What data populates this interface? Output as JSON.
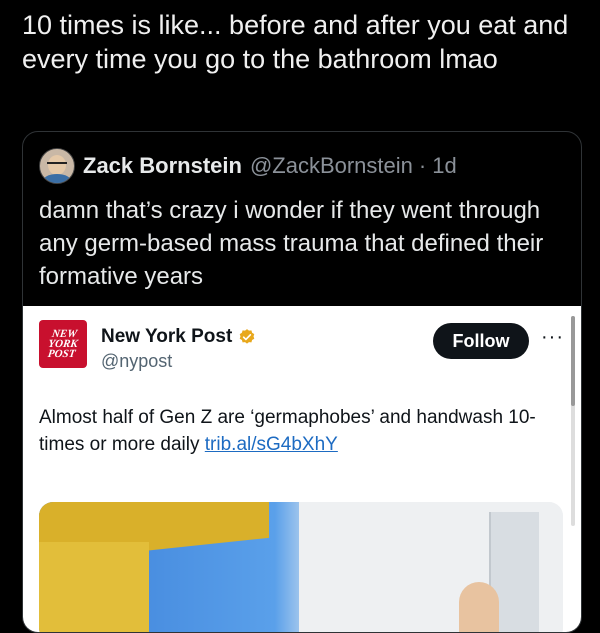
{
  "tweet": {
    "text": "10 times is like... before and after you eat and every time you go to the bathroom lmao"
  },
  "quote": {
    "author_name": "Zack Bornstein",
    "author_handle": "@ZackBornstein",
    "separator": "·",
    "time": "1d",
    "text": "damn that’s crazy i wonder if they went through any germ-based mass trauma that defined their formative years"
  },
  "embed": {
    "logo_text": "NEW YORK POST",
    "name": "New York Post",
    "handle": "@nypost",
    "follow_label": "Follow",
    "more_label": "···",
    "text": "Almost half of Gen Z are ‘germaphobes’ and handwash 10-times or more daily ",
    "link_text": "trib.al/sG4bXhY"
  },
  "colors": {
    "background": "#000000",
    "brand_red": "#c8102e",
    "verified_gold": "#e8a81c",
    "link_blue": "#1d6bc2"
  }
}
